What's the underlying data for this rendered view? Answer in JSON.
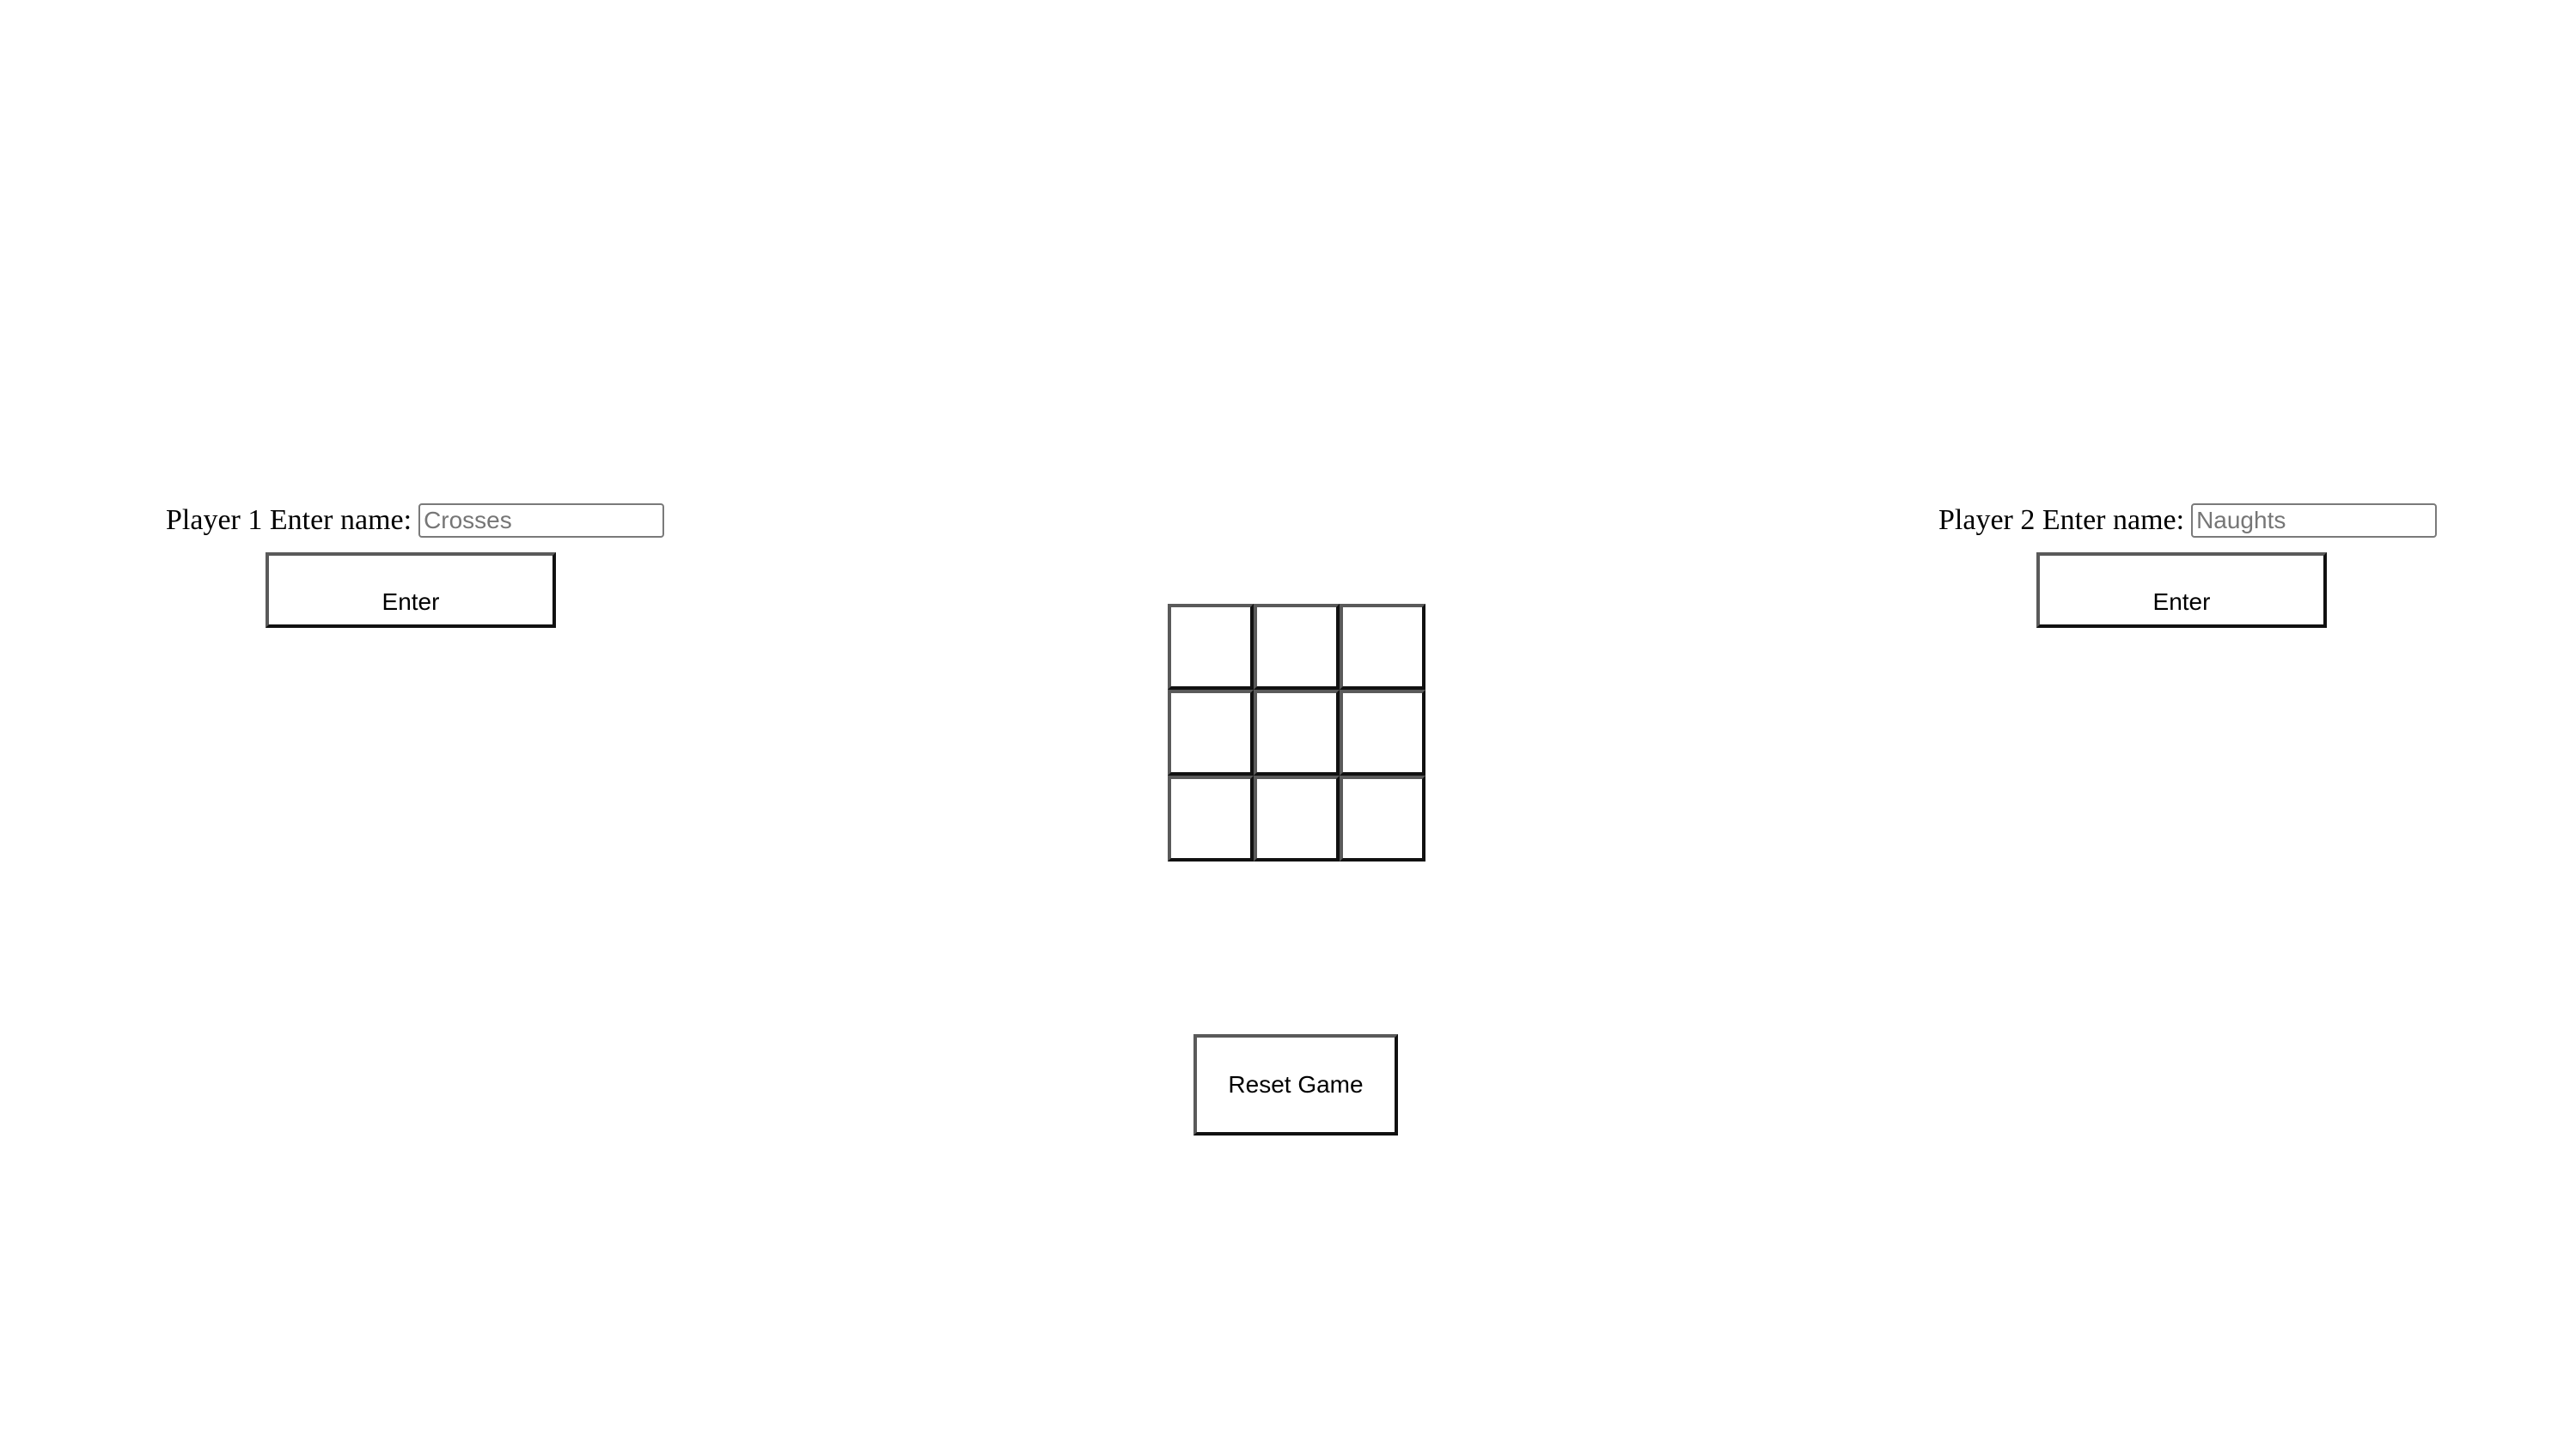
{
  "player1": {
    "label": "Player 1 Enter name:",
    "input_value": "",
    "input_placeholder": "Crosses",
    "enter_label": "Enter"
  },
  "player2": {
    "label": "Player 2 Enter name:",
    "input_value": "",
    "input_placeholder": "Naughts",
    "enter_label": "Enter"
  },
  "board": {
    "cells": [
      "",
      "",
      "",
      "",
      "",
      "",
      "",
      "",
      ""
    ]
  },
  "reset": {
    "label": "Reset Game"
  }
}
